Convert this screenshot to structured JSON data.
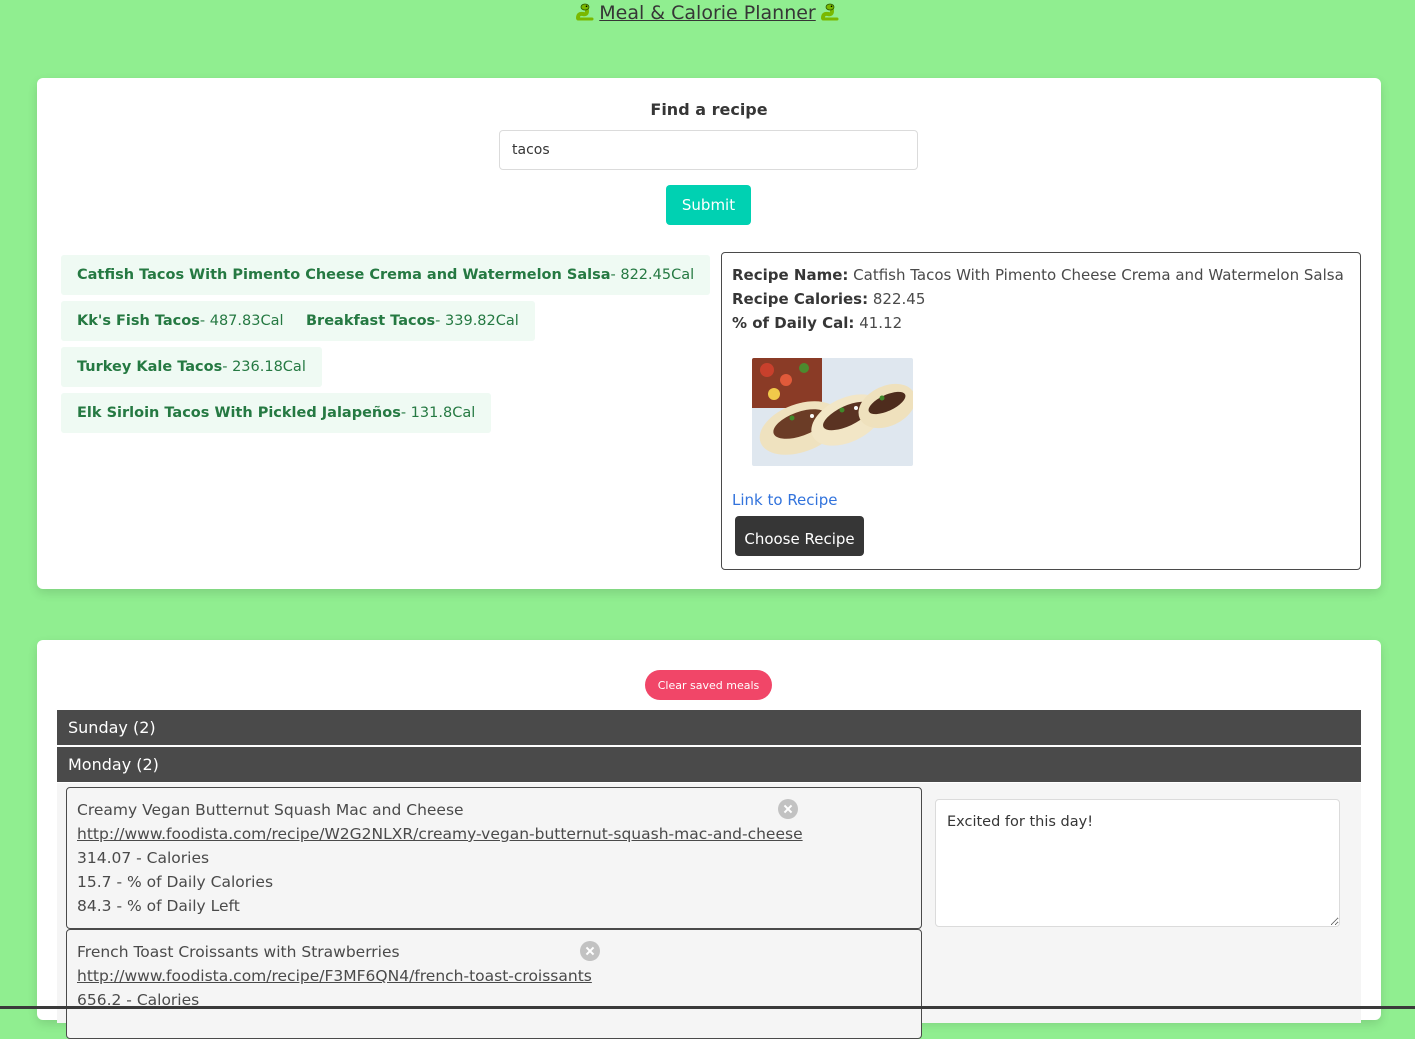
{
  "header": {
    "title": "Meal & Calorie Planner",
    "icon": "snake-icon"
  },
  "search": {
    "label": "Find a recipe",
    "value": "tacos",
    "submit_label": "Submit"
  },
  "results": [
    {
      "name": "Catfish Tacos With Pimento Cheese Crema and Watermelon Salsa",
      "calories": "- 822.45Cal"
    },
    {
      "name": "Kk's Fish Tacos",
      "calories": "- 487.83Cal"
    },
    {
      "name": "Breakfast Tacos",
      "calories": "- 339.82Cal"
    },
    {
      "name": "Turkey Kale Tacos",
      "calories": "- 236.18Cal"
    },
    {
      "name": "Elk Sirloin Tacos With Pickled Jalapeños",
      "calories": "- 131.8Cal"
    }
  ],
  "detail": {
    "name_label": "Recipe Name:",
    "name": "Catfish Tacos With Pimento Cheese Crema and Watermelon Salsa",
    "calories_label": "Recipe Calories:",
    "calories": "822.45",
    "daily_label": "% of Daily Cal:",
    "daily": "41.12",
    "link_label": "Link to Recipe",
    "choose_label": "Choose Recipe"
  },
  "planner": {
    "clear_label": "Clear saved meals",
    "days": [
      {
        "label": "Sunday (2)"
      },
      {
        "label": "Monday (2)"
      }
    ],
    "meals": [
      {
        "name": "Creamy Vegan Butternut Squash Mac and Cheese",
        "url": "http://www.foodista.com/recipe/W2G2NLXR/creamy-vegan-butternut-squash-mac-and-cheese",
        "calories": "314.07 - Calories",
        "daily": "15.7 - % of Daily Calories",
        "left": "84.3 - % of Daily Left"
      },
      {
        "name": "French Toast Croissants with Strawberries",
        "url": "http://www.foodista.com/recipe/F3MF6QN4/french-toast-croissants",
        "calories": "656.2 - Calories"
      }
    ],
    "notes": "Excited for this day!"
  },
  "colors": {
    "background": "#90ee90",
    "primary": "#00d1b2",
    "danger": "#f14668",
    "dark": "#363636",
    "tag_bg": "#effaf3",
    "tag_text": "#257942",
    "link": "#3273dc"
  }
}
